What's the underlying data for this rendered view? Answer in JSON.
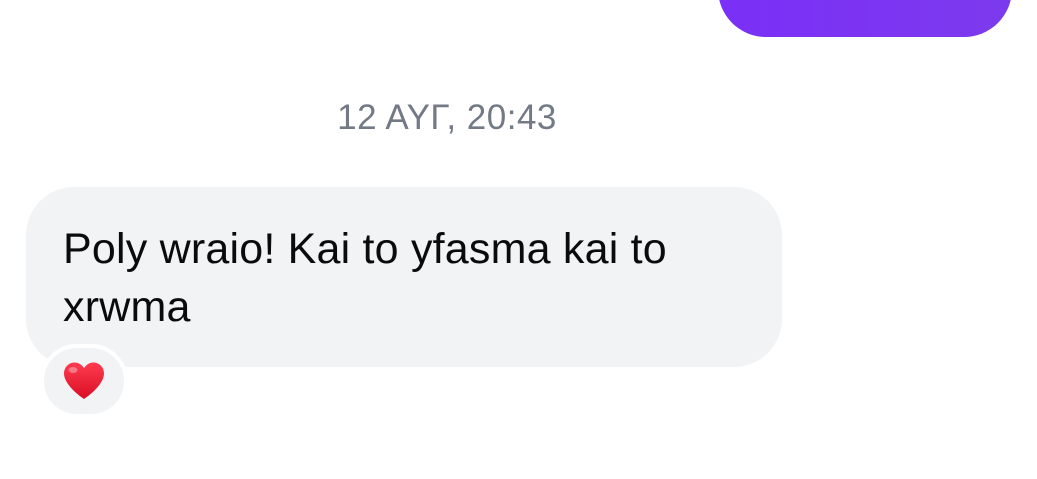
{
  "conversation": {
    "sent_message": {
      "visible_text": ""
    },
    "timestamp": "12 ΑΥΓ, 20:43",
    "received_message": {
      "text": "Poly wraio! Kai to yfasma kai to xrwma",
      "reaction_icon": "heart-icon"
    }
  },
  "colors": {
    "sent_bubble": "#7c3aed",
    "received_bubble": "#f2f3f5",
    "timestamp_text": "#737a85",
    "message_text": "#0b0b0b",
    "heart": "#e8142b"
  }
}
